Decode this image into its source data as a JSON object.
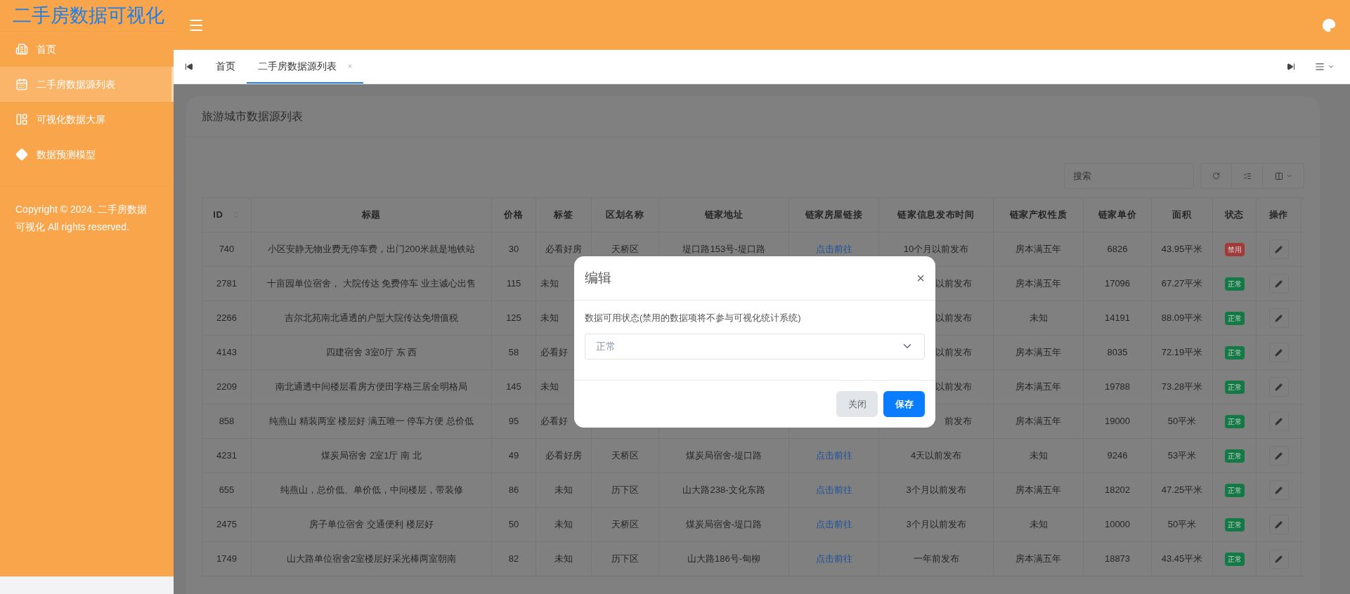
{
  "sidebar": {
    "logo": "二手房数据可视化",
    "items": [
      {
        "label": "首页",
        "selected": false
      },
      {
        "label": "二手房数据源列表",
        "selected": true
      },
      {
        "label": "可视化数据大屏",
        "selected": false
      },
      {
        "label": "数据预测模型",
        "selected": false
      }
    ],
    "copyright": "Copyright © 2024. 二手房数据可视化 All rights reserved."
  },
  "tabs": [
    {
      "label": "首页",
      "selected": false,
      "closable": false
    },
    {
      "label": "二手房数据源列表",
      "selected": true,
      "closable": true,
      "close": "×"
    }
  ],
  "card": {
    "title": "旅游城市数据源列表",
    "search": {
      "placeholder": "搜索"
    }
  },
  "table": {
    "columns": [
      "ID",
      "标题",
      "价格",
      "标签",
      "区划名称",
      "链家地址",
      "链家房屋链接",
      "链家信息发布时间",
      "链家产权性质",
      "链家单价",
      "面积",
      "状态",
      "操作"
    ],
    "rows": [
      {
        "id": "740",
        "title": "小区安静无物业费无停车费，出门200米就是地铁站",
        "price": "30",
        "tag": "必看好房",
        "district": "天桥区",
        "address": "堤口路153号-堤口路",
        "link": "点击前往",
        "time": "10个月以前发布",
        "property": "房本满五年",
        "unit_price": "6826",
        "area": "43.95平米",
        "status": "禁用",
        "enabled": false,
        "covered": false
      },
      {
        "id": "2781",
        "title": "十亩园单位宿舍， 大院传达 免费停车 业主诚心出售",
        "price": "115",
        "tag": "未知",
        "time": "以前发布",
        "property": "房本满五年",
        "unit_price": "17096",
        "area": "67.27平米",
        "status": "正常",
        "enabled": true,
        "covered": true
      },
      {
        "id": "2266",
        "title": "吉尔北苑南北通透的户型大院传达免增值税",
        "price": "125",
        "tag": "未知",
        "time": "以前发布",
        "property": "未知",
        "unit_price": "14191",
        "area": "88.09平米",
        "status": "正常",
        "enabled": true,
        "covered": true
      },
      {
        "id": "4143",
        "title": "四建宿舍 3室0厅 东 西",
        "price": "58",
        "tag": "必看好",
        "time": "以前发布",
        "property": "房本满五年",
        "unit_price": "8035",
        "area": "72.19平米",
        "status": "正常",
        "enabled": true,
        "covered": true
      },
      {
        "id": "2209",
        "title": "南北通透中间楼层看房方便田字格三居全明格局",
        "price": "145",
        "tag": "未知",
        "time": "以前发布",
        "property": "房本满五年",
        "unit_price": "19788",
        "area": "73.28平米",
        "status": "正常",
        "enabled": true,
        "covered": true
      },
      {
        "id": "858",
        "title": "纯燕山 精装两室 楼层好 满五唯一 停车方便 总价低",
        "price": "95",
        "tag": "必看好",
        "time": "前发布",
        "property": "房本满五年",
        "unit_price": "19000",
        "area": "50平米",
        "status": "正常",
        "enabled": true,
        "covered": true
      },
      {
        "id": "4231",
        "title": "煤炭局宿舍 2室1厅 南 北",
        "price": "49",
        "tag": "必看好房",
        "district": "天桥区",
        "address": "煤炭局宿舍-堤口路",
        "link": "点击前往",
        "time": "4天以前发布",
        "property": "未知",
        "unit_price": "9246",
        "area": "53平米",
        "status": "正常",
        "enabled": true,
        "covered": false
      },
      {
        "id": "655",
        "title": "纯燕山，总价低、单价低，中间楼层，带装修",
        "price": "86",
        "tag": "未知",
        "district": "历下区",
        "address": "山大路238-文化东路",
        "link": "点击前往",
        "time": "3个月以前发布",
        "property": "房本满五年",
        "unit_price": "18202",
        "area": "47.25平米",
        "status": "正常",
        "enabled": true,
        "covered": false
      },
      {
        "id": "2475",
        "title": "房子单位宿舍 交通便利 楼层好",
        "price": "50",
        "tag": "未知",
        "district": "天桥区",
        "address": "煤炭局宿舍-堤口路",
        "link": "点击前往",
        "time": "3个月以前发布",
        "property": "未知",
        "unit_price": "10000",
        "area": "50平米",
        "status": "正常",
        "enabled": true,
        "covered": false
      },
      {
        "id": "1749",
        "title": "山大路单位宿舍2室楼层好采光棒两室朝南",
        "price": "82",
        "tag": "未知",
        "district": "历下区",
        "address": "山大路186号-甸柳",
        "link": "点击前往",
        "time": "一年前发布",
        "property": "房本满五年",
        "unit_price": "18873",
        "area": "43.45平米",
        "status": "正常",
        "enabled": true,
        "covered": false
      }
    ]
  },
  "dialog": {
    "title": "编辑",
    "close": "×",
    "label": "数据可用状态(禁用的数据项将不参与可视化统计系统)",
    "select_value": "正常",
    "buttons": [
      {
        "label": "关闭",
        "kind": "secondary"
      },
      {
        "label": "保存",
        "kind": "primary"
      }
    ]
  }
}
